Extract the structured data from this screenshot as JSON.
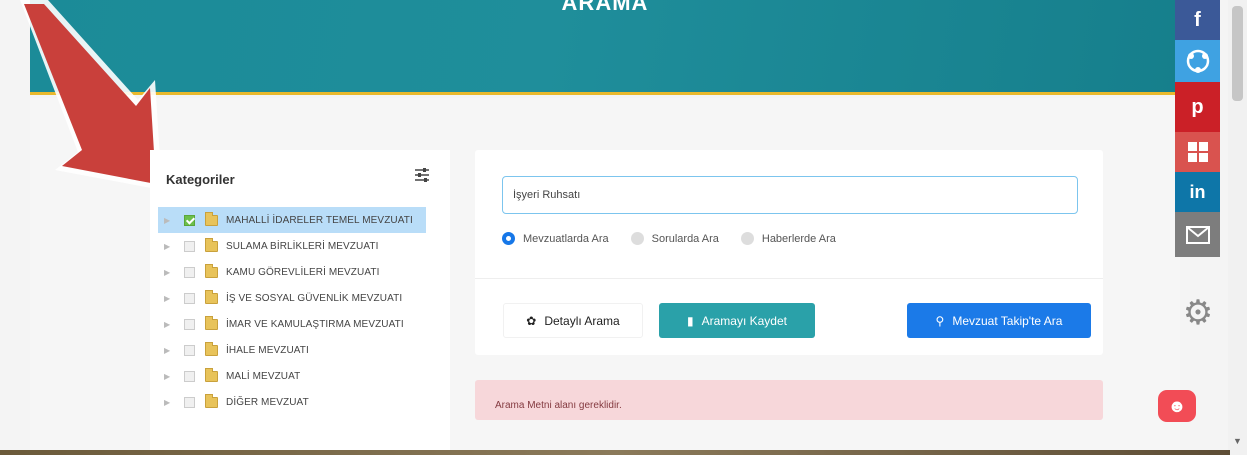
{
  "banner": {
    "title": "ARAMA"
  },
  "sidebar": {
    "heading": "Kategoriler",
    "filter_icon": "sliders-icon",
    "categories": [
      {
        "label": "MAHALLİ İDARELER TEMEL MEVZUATI",
        "checked": true,
        "selected": true
      },
      {
        "label": "SULAMA BİRLİKLERİ MEVZUATI",
        "checked": false,
        "selected": false
      },
      {
        "label": "KAMU GÖREVLİLERİ MEVZUATI",
        "checked": false,
        "selected": false
      },
      {
        "label": "İŞ VE SOSYAL GÜVENLİK MEVZUATI",
        "checked": false,
        "selected": false
      },
      {
        "label": "İMAR VE KAMULAŞTIRMA MEVZUATI",
        "checked": false,
        "selected": false
      },
      {
        "label": "İHALE MEVZUATI",
        "checked": false,
        "selected": false
      },
      {
        "label": "MALİ MEVZUAT",
        "checked": false,
        "selected": false
      },
      {
        "label": "DİĞER MEVZUAT",
        "checked": false,
        "selected": false
      }
    ]
  },
  "search": {
    "value": "İşyeri Ruhsatı",
    "radios": [
      {
        "label": "Mevzuatlarda Ara",
        "selected": true
      },
      {
        "label": "Sorularda Ara",
        "selected": false
      },
      {
        "label": "Haberlerde Ara",
        "selected": false
      }
    ],
    "buttons": {
      "detail": "Detaylı Arama",
      "save": "Aramayı Kaydet",
      "takip": "Mevzuat Takip'te Ara"
    }
  },
  "alert": {
    "message": "Arama Metni alanı gereklidir."
  },
  "social": {
    "facebook": "f",
    "share": "share-icon",
    "pinterest": "p",
    "windows": "windows-icon",
    "linkedin": "in",
    "mail": "mail-icon"
  },
  "colors": {
    "banner": "#1b8b98",
    "accent_line": "#e9b92d",
    "primary": "#1677e8",
    "teal_button": "#2aa1a9",
    "alert_bg": "#f7d7da",
    "arrow": "#c9403b"
  }
}
